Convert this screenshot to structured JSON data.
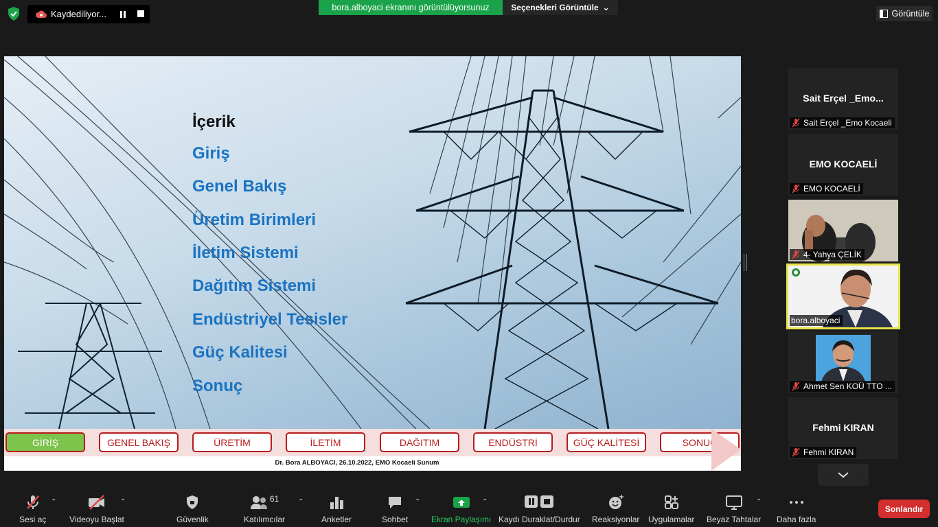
{
  "top": {
    "recording_label": "Kaydediliyor...",
    "share_banner": "bora.alboyaci  ekranını görüntülüyorsunuz",
    "view_options": "Seçenekleri Görüntüle",
    "view_button": "Görüntüle"
  },
  "slide": {
    "toc_heading": "İçerik",
    "toc_items": [
      "Giriş",
      "Genel Bakış",
      "Üretim Birimleri",
      "İletim Sistemi",
      "Dağıtım Sistemi",
      "Endüstriyel Tesisler",
      "Güç Kalitesi",
      "Sonuç"
    ],
    "nav_buttons": [
      "GİRİŞ",
      "GENEL BAKIŞ",
      "ÜRETİM",
      "İLETİM",
      "DAĞITIM",
      "ENDÜSTRİ",
      "GÜÇ KALİTESİ",
      "SONUÇ"
    ],
    "active_nav": "GİRİŞ",
    "footer": "Dr. Bora ALBOYACI, 26.10.2022, EMO Kocaeli Sunum"
  },
  "participants": [
    {
      "big_name": "Sait  Erçel  _Emo...",
      "label": "Sait Erçel _Emo Kocaeli",
      "muted": true
    },
    {
      "big_name": "EMO KOCAELİ",
      "label": "EMO KOCAELİ",
      "muted": true
    },
    {
      "label": "4- Yahya ÇELİK",
      "muted": true,
      "video": true
    },
    {
      "label": "bora.alboyaci",
      "muted": false,
      "video": true,
      "speaking": true
    },
    {
      "label": "Ahmet Sen KOÜ TTO ...",
      "muted": true,
      "photo": true
    },
    {
      "big_name": "Fehmi KIRAN",
      "label": "Fehmi KIRAN",
      "muted": true
    }
  ],
  "toolbar": {
    "audio": "Sesi aç",
    "video": "Videoyu Başlat",
    "security": "Güvenlik",
    "participants": "Katılımcılar",
    "participant_count": "61",
    "polls": "Anketler",
    "chat": "Sohbet",
    "share": "Ekran Paylaşımı",
    "record": "Kaydı Duraklat/Durdur",
    "reactions": "Reaksiyonlar",
    "apps": "Uygulamalar",
    "whiteboards": "Beyaz Tahtalar",
    "more": "Daha fazla",
    "end": "Sonlandır"
  },
  "colors": {
    "share_green": "#1aa34a",
    "end_red": "#d32f2f",
    "toc_blue": "#1a73c1",
    "nav_red": "#b71c1c",
    "active_green": "#7cc44b",
    "speaker_outline": "#e8e24a"
  }
}
